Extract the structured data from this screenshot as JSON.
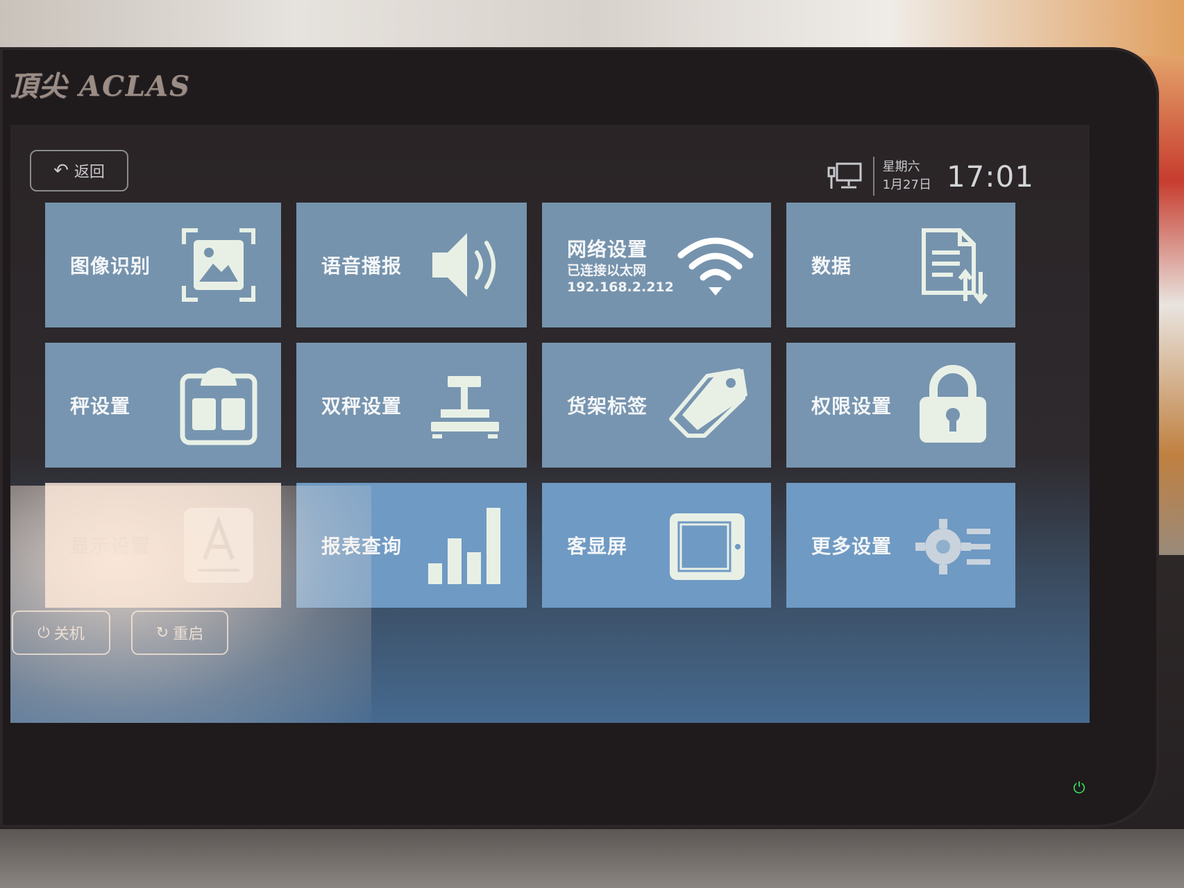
{
  "brand": "頂尖 ACLAS",
  "top_bar": {
    "back_label": "返回",
    "weekday": "星期六",
    "date": "1月27日",
    "time": "17:01"
  },
  "tiles": [
    {
      "label": "图像识别",
      "icon": "image-recognition-icon"
    },
    {
      "label": "语音播报",
      "icon": "speaker-icon"
    },
    {
      "label": "网络设置",
      "sub1": "已连接以太网",
      "sub2": "192.168.2.212",
      "icon": "wifi-icon"
    },
    {
      "label": "数据",
      "icon": "data-transfer-icon"
    },
    {
      "label": "秤设置",
      "icon": "scale-icon"
    },
    {
      "label": "双秤设置",
      "icon": "dual-scale-icon"
    },
    {
      "label": "货架标签",
      "icon": "price-tag-icon"
    },
    {
      "label": "权限设置",
      "icon": "lock-icon"
    },
    {
      "label": "显示设置",
      "icon": "display-font-icon"
    },
    {
      "label": "报表查询",
      "icon": "bar-chart-icon"
    },
    {
      "label": "客显屏",
      "icon": "customer-display-icon"
    },
    {
      "label": "更多设置",
      "icon": "gear-icon"
    }
  ],
  "bottom": {
    "shutdown_label": "关机",
    "restart_label": "重启"
  },
  "colors": {
    "tile": "#7693ad",
    "tile_lower": "#6f9ac3",
    "screen_bg": "#2a2426",
    "power_led": "#38e05a"
  }
}
